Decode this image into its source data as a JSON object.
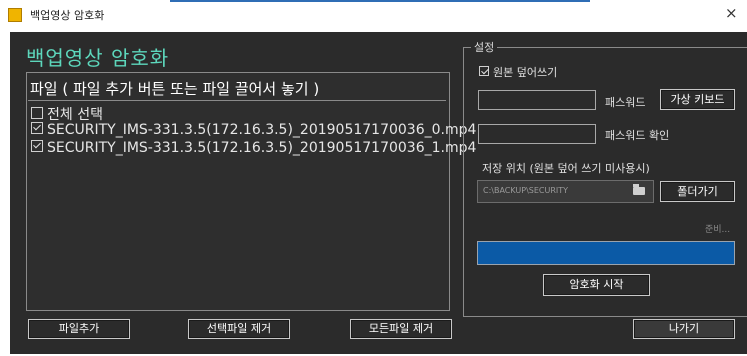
{
  "window": {
    "title": "백업영상 암호화",
    "close_glyph": "×"
  },
  "main": {
    "title": "백업영상 암호화",
    "file_list": {
      "header": "파일 ( 파일 추가 버튼 또는 파일 끌어서 놓기 )",
      "select_all": {
        "label": "전체 선택",
        "checked": false
      },
      "items": [
        {
          "name": "SECURITY_IMS-331.3.5(172.16.3.5)_20190517170036_0.mp4",
          "checked": true
        },
        {
          "name": "SECURITY_IMS-331.3.5(172.16.3.5)_20190517170036_1.mp4",
          "checked": true
        }
      ]
    },
    "buttons": {
      "add_file": "파일추가",
      "remove_selected": "선택파일 제거",
      "remove_all": "모든파일 제거"
    }
  },
  "settings": {
    "title": "설정",
    "overwrite": {
      "label": "원본 덮어쓰기",
      "checked": true
    },
    "password_label": "패스워드",
    "password_value": "",
    "virtual_keyboard": "가상 키보드",
    "password_confirm_label": "패스워드 확인",
    "password_confirm_value": "",
    "save_location_label": "저장 위치 (원본 덮어 쓰기 미사용시)",
    "save_path": "C:\\BACKUP\\SECURITY",
    "browse_button": "폴더가기",
    "status": "준비...",
    "progress": 1.0,
    "start_button": "암호화 시작"
  },
  "footer": {
    "exit_button": "나가기"
  },
  "colors": {
    "accent_title": "#5dd7bc",
    "panel_bg": "#2b2b2b",
    "progress_fill": "#0b5aa6"
  }
}
